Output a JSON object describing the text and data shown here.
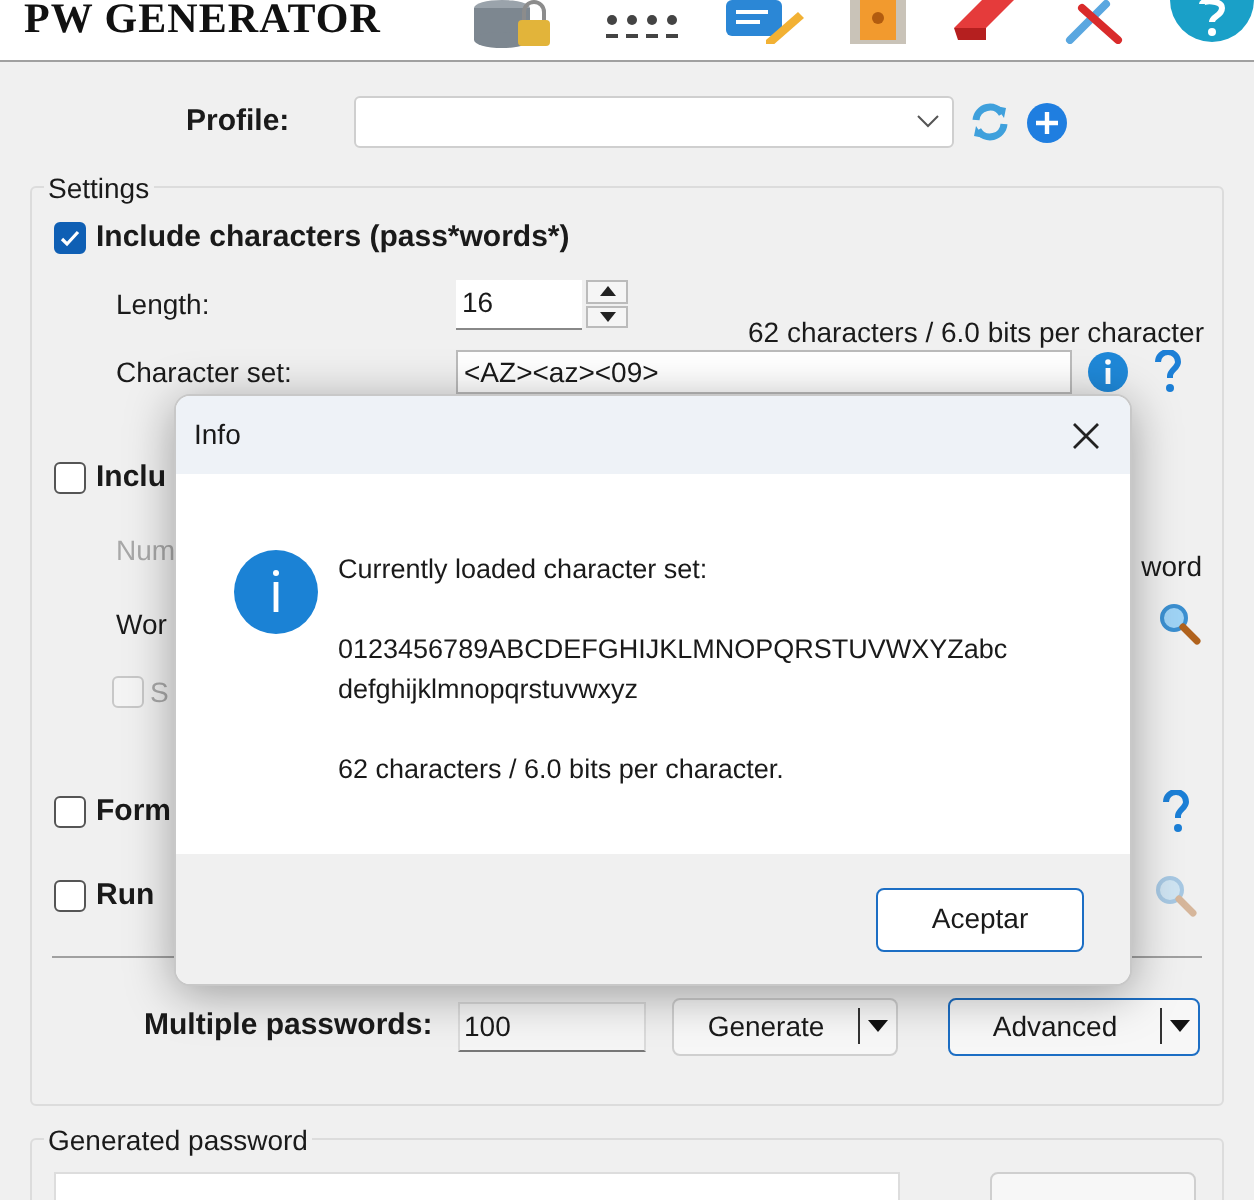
{
  "header": {
    "title": "PW GENERATOR"
  },
  "profile": {
    "label": "Profile:"
  },
  "settings": {
    "title": "Settings",
    "include_characters": {
      "label": "Include characters (pass*words*)",
      "checked": true
    },
    "length": {
      "label": "Length:",
      "value": "16"
    },
    "charset_summary": "62 characters / 6.0 bits per character",
    "character_set": {
      "label": "Character set:",
      "value": "<AZ><az><09>"
    },
    "include_words": {
      "label": "Inclu",
      "checked": false
    },
    "number_label": "Num",
    "word_note": "word",
    "words_label": "Wor",
    "sub_option": {
      "label": "S",
      "checked": false,
      "disabled": true
    },
    "format": {
      "label": "Form",
      "checked": false
    },
    "run_script": {
      "label": "Run",
      "checked": false
    },
    "multiple": {
      "label": "Multiple passwords:",
      "value": "100"
    },
    "buttons": [
      {
        "label": "Generate",
        "focused": false
      },
      {
        "label": "Advanced",
        "focused": true
      }
    ]
  },
  "generated": {
    "title": "Generated password"
  },
  "dialog": {
    "title": "Info",
    "heading": "Currently loaded character set:",
    "charset": "0123456789ABCDEFGHIJKLMNOPQRSTUVWXYZabcdefghijklmnopqrstuvwxyz",
    "summary": "62 characters / 6.0 bits per character.",
    "button": "Aceptar"
  }
}
